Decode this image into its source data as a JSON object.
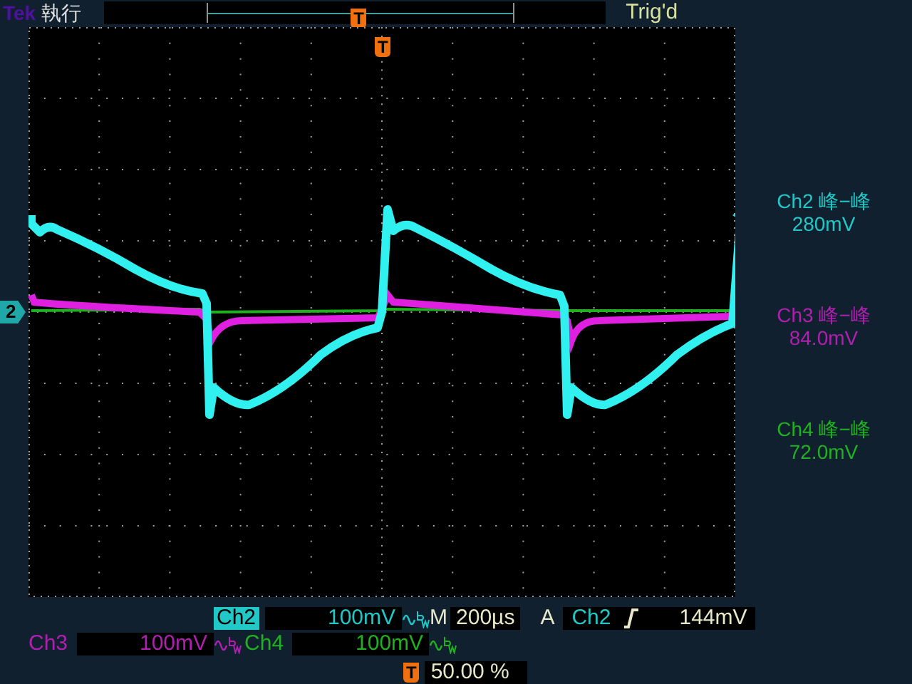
{
  "header": {
    "brand": "Tek",
    "status": "執行",
    "trigger_marker": "T",
    "trigger_status": "Trig'd"
  },
  "graticule": {
    "trigger_marker": "T",
    "channel_marker": "2"
  },
  "measurements": [
    {
      "channel": "Ch2",
      "label": "峰−峰",
      "value": "280mV",
      "color": "#20c8c8"
    },
    {
      "channel": "Ch3",
      "label": "峰−峰",
      "value": "84.0mV",
      "color": "#b020b0"
    },
    {
      "channel": "Ch4",
      "label": "峰−峰",
      "value": "72.0mV",
      "color": "#20b020"
    }
  ],
  "channels": [
    {
      "name": "Ch2",
      "scale": "100mV",
      "color": "#20c8c8",
      "selected": true,
      "bandwidth_limited": true
    },
    {
      "name": "Ch3",
      "scale": "100mV",
      "color": "#b020b0",
      "selected": false,
      "bandwidth_limited": true
    },
    {
      "name": "Ch4",
      "scale": "100mV",
      "color": "#20b020",
      "selected": false,
      "bandwidth_limited": true
    }
  ],
  "timebase": {
    "label": "M",
    "value": "200µs"
  },
  "trigger": {
    "label": "A",
    "source": "Ch2",
    "slope": {
      "kind": "rising"
    },
    "level": "144mV"
  },
  "horizontal_position": {
    "marker": "T",
    "value": "50.00 %"
  }
}
